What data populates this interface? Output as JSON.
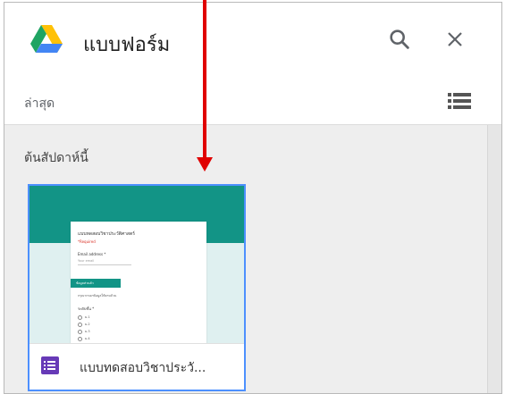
{
  "header": {
    "title": "แบบฟอร์ม",
    "logo_icon": "google-drive-logo",
    "search_icon": "search-icon",
    "close_icon": "close-icon"
  },
  "subbar": {
    "sort_label": "ล่าสุด",
    "view_icon": "list-view-icon"
  },
  "content": {
    "section_label": "ต้นสัปดาห์นี้",
    "files": [
      {
        "name": "แบบทดสอบวิชาประวั...",
        "type_icon": "google-forms-icon",
        "thumbnail": {
          "form_title": "แบบทดสอบวิชาประวัติศาสตร์",
          "required_note": "*Required",
          "question1": "Email address *",
          "placeholder": "Your email",
          "section_header": "ข้อมูลส่วนตัว",
          "description": "กรุณากรอกข้อมูลให้ครบถ้วน",
          "question2": "ระดับชั้น *",
          "options": [
            "ม.1",
            "ม.2",
            "ม.3",
            "ม.4"
          ]
        }
      }
    ]
  },
  "colors": {
    "accent_teal": "#129486",
    "forms_purple": "#673ab7",
    "selection_blue": "#4d90fe",
    "annotation_red": "#e00000"
  }
}
